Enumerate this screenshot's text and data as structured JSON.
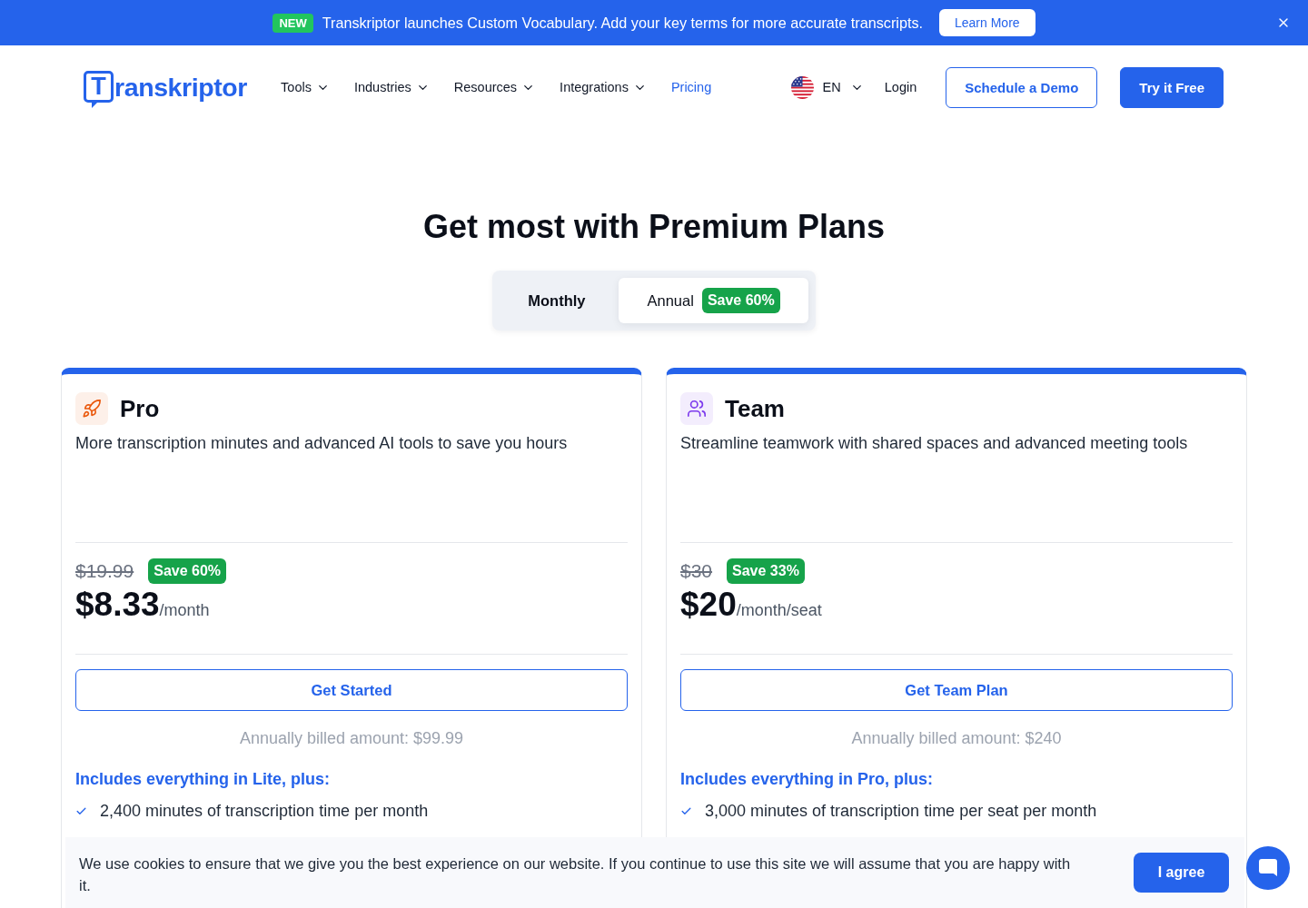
{
  "announcement": {
    "badge": "NEW",
    "text": "Transkriptor launches Custom Vocabulary. Add your key terms for more accurate transcripts.",
    "button": "Learn More"
  },
  "nav": {
    "logo": {
      "initial": "T",
      "rest": "ranskriptor"
    },
    "menu": [
      {
        "label": "Tools",
        "has_dropdown": true,
        "selected": false
      },
      {
        "label": "Industries",
        "has_dropdown": true,
        "selected": false
      },
      {
        "label": "Resources",
        "has_dropdown": true,
        "selected": false
      },
      {
        "label": "Integrations",
        "has_dropdown": true,
        "selected": false
      },
      {
        "label": "Pricing",
        "has_dropdown": false,
        "selected": true
      }
    ],
    "language": "EN",
    "login": "Login",
    "buttons": [
      {
        "label": "Schedule a Demo",
        "kind": "outline"
      },
      {
        "label": "Try it Free",
        "kind": "solid"
      }
    ]
  },
  "heading": "Get most with Premium Plans",
  "billing_toggle": [
    {
      "label": "Monthly",
      "selected": false
    },
    {
      "label": "Annual",
      "selected": true,
      "badge": "Save 60%"
    }
  ],
  "plans": [
    {
      "name": "Pro",
      "color": "#ea580c",
      "description": "More transcription minutes and advanced AI tools to save you hours",
      "old_price": "$19.99",
      "save": "Save 60%",
      "price": "$8.33",
      "period": "/month",
      "button": "Get Started",
      "billing_note": "Annually billed amount: $99.99",
      "includes": "Includes everything in Lite, plus:",
      "features": [
        "2,400 minutes of transcription time per month"
      ]
    },
    {
      "name": "Team",
      "color": "#7c3aed",
      "description": "Streamline teamwork with shared spaces and advanced meeting tools",
      "old_price": "$30",
      "save": "Save 33%",
      "price": "$20",
      "period": "/month/seat",
      "button": "Get Team Plan",
      "billing_note": "Annually billed amount: $240",
      "includes": "Includes everything in Pro, plus:",
      "features": [
        "3,000 minutes of transcription time per seat per month"
      ]
    }
  ],
  "cookie_notice": {
    "text": "We use cookies to ensure that we give you the best experience on our website. If you continue to use this site we will assume that you are happy with it.",
    "button": "I agree"
  }
}
